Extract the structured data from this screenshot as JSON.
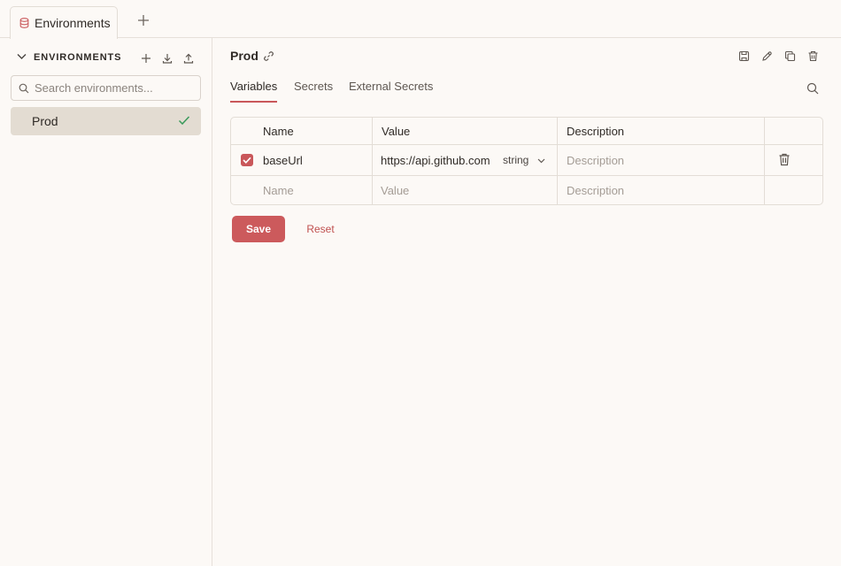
{
  "tabbar": {
    "tab_label": "Environments",
    "icons": {
      "tab": "database-icon",
      "new_tab": "plus-icon"
    }
  },
  "sidebar": {
    "title": "ENVIRONMENTS",
    "search": {
      "placeholder": "Search environments...",
      "value": ""
    },
    "actions": [
      "plus-icon",
      "download-icon",
      "upload-icon"
    ],
    "environments": [
      {
        "name": "Prod",
        "active": true
      }
    ]
  },
  "main": {
    "title": "Prod",
    "header_actions": [
      "save-icon",
      "edit-icon",
      "copy-icon",
      "trash-icon"
    ],
    "tabs": [
      {
        "label": "Variables",
        "active": true
      },
      {
        "label": "Secrets",
        "active": false
      },
      {
        "label": "External Secrets",
        "active": false
      }
    ],
    "table": {
      "columns": [
        "Name",
        "Value",
        "Description"
      ],
      "rows": [
        {
          "enabled": true,
          "name": "baseUrl",
          "value": "https://api.github.com",
          "type": "string",
          "description_placeholder": "Description"
        }
      ],
      "new_row": {
        "name_placeholder": "Name",
        "value_placeholder": "Value",
        "description_placeholder": "Description"
      }
    },
    "buttons": {
      "save": "Save",
      "reset": "Reset"
    }
  },
  "colors": {
    "accent": "#cc5a5c",
    "background": "#fcf9f6",
    "selected_item": "#e3dcd2",
    "success_check": "#3a9a5b"
  }
}
